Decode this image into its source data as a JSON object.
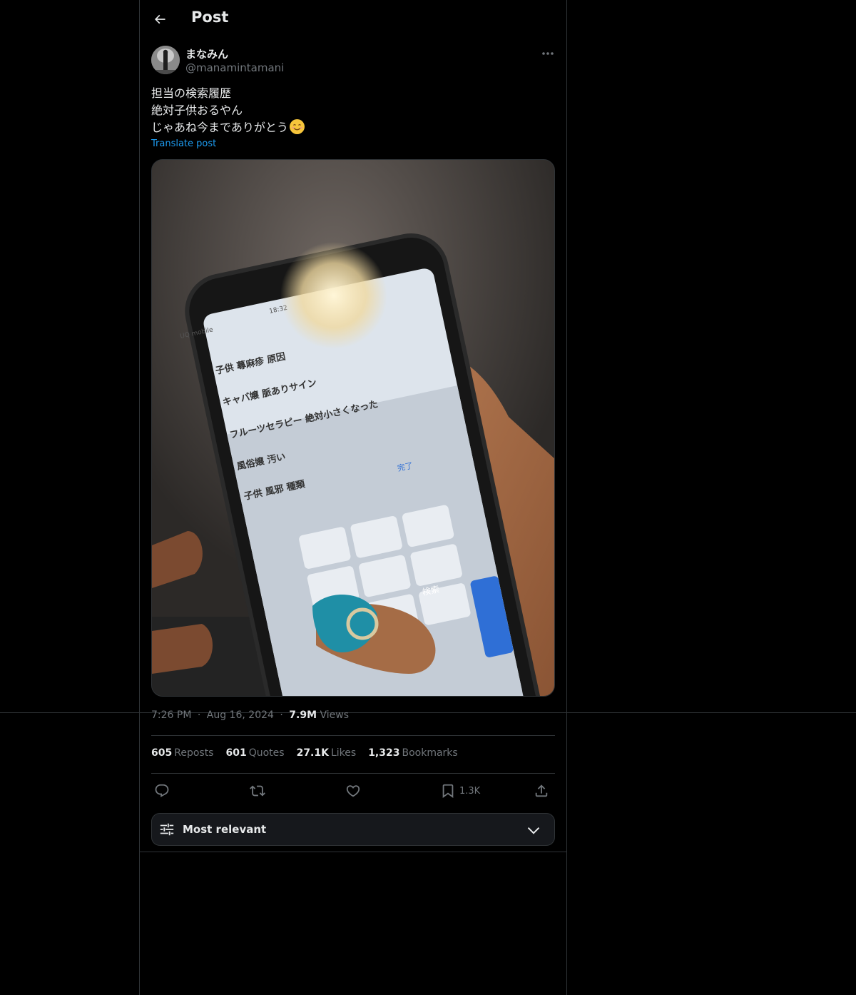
{
  "header": {
    "title": "Post",
    "back_icon": "arrow-left-icon"
  },
  "author": {
    "display_name": "まなみん",
    "handle": "@manamintamani"
  },
  "post": {
    "lines": [
      "担当の検索履歴",
      "絶対子供おるやん",
      "じゃあね今までありがとう"
    ],
    "emoji": "smiling-face-icon",
    "translate_label": "Translate post"
  },
  "media": {
    "type": "photo",
    "search_history": [
      "子供 蕁麻疹 原因",
      "キャバ嬢 脈ありサイン",
      "フルーツセラピー 絶対小さくなった",
      "風俗嬢 汚い",
      "子供 風邪 種類"
    ],
    "done_label": "完了",
    "search_key_label": "検索",
    "status_bar_label": "UQ mobile",
    "status_time": "18:32"
  },
  "meta": {
    "time": "7:26 PM",
    "sep": "·",
    "date": "Aug 16, 2024",
    "views_count": "7.9M",
    "views_label": "Views"
  },
  "stats": {
    "reposts_count": "605",
    "reposts_label": "Reposts",
    "quotes_count": "601",
    "quotes_label": "Quotes",
    "likes_count": "27.1K",
    "likes_label": "Likes",
    "bookmarks_count": "1,323",
    "bookmarks_label": "Bookmarks"
  },
  "actions": {
    "bookmark_count": "1.3K"
  },
  "sort": {
    "label": "Most relevant"
  },
  "colors": {
    "background": "#000000",
    "border": "#2f3336",
    "link": "#1d9bf0",
    "muted": "#71767b",
    "text": "#e7e9ea"
  }
}
